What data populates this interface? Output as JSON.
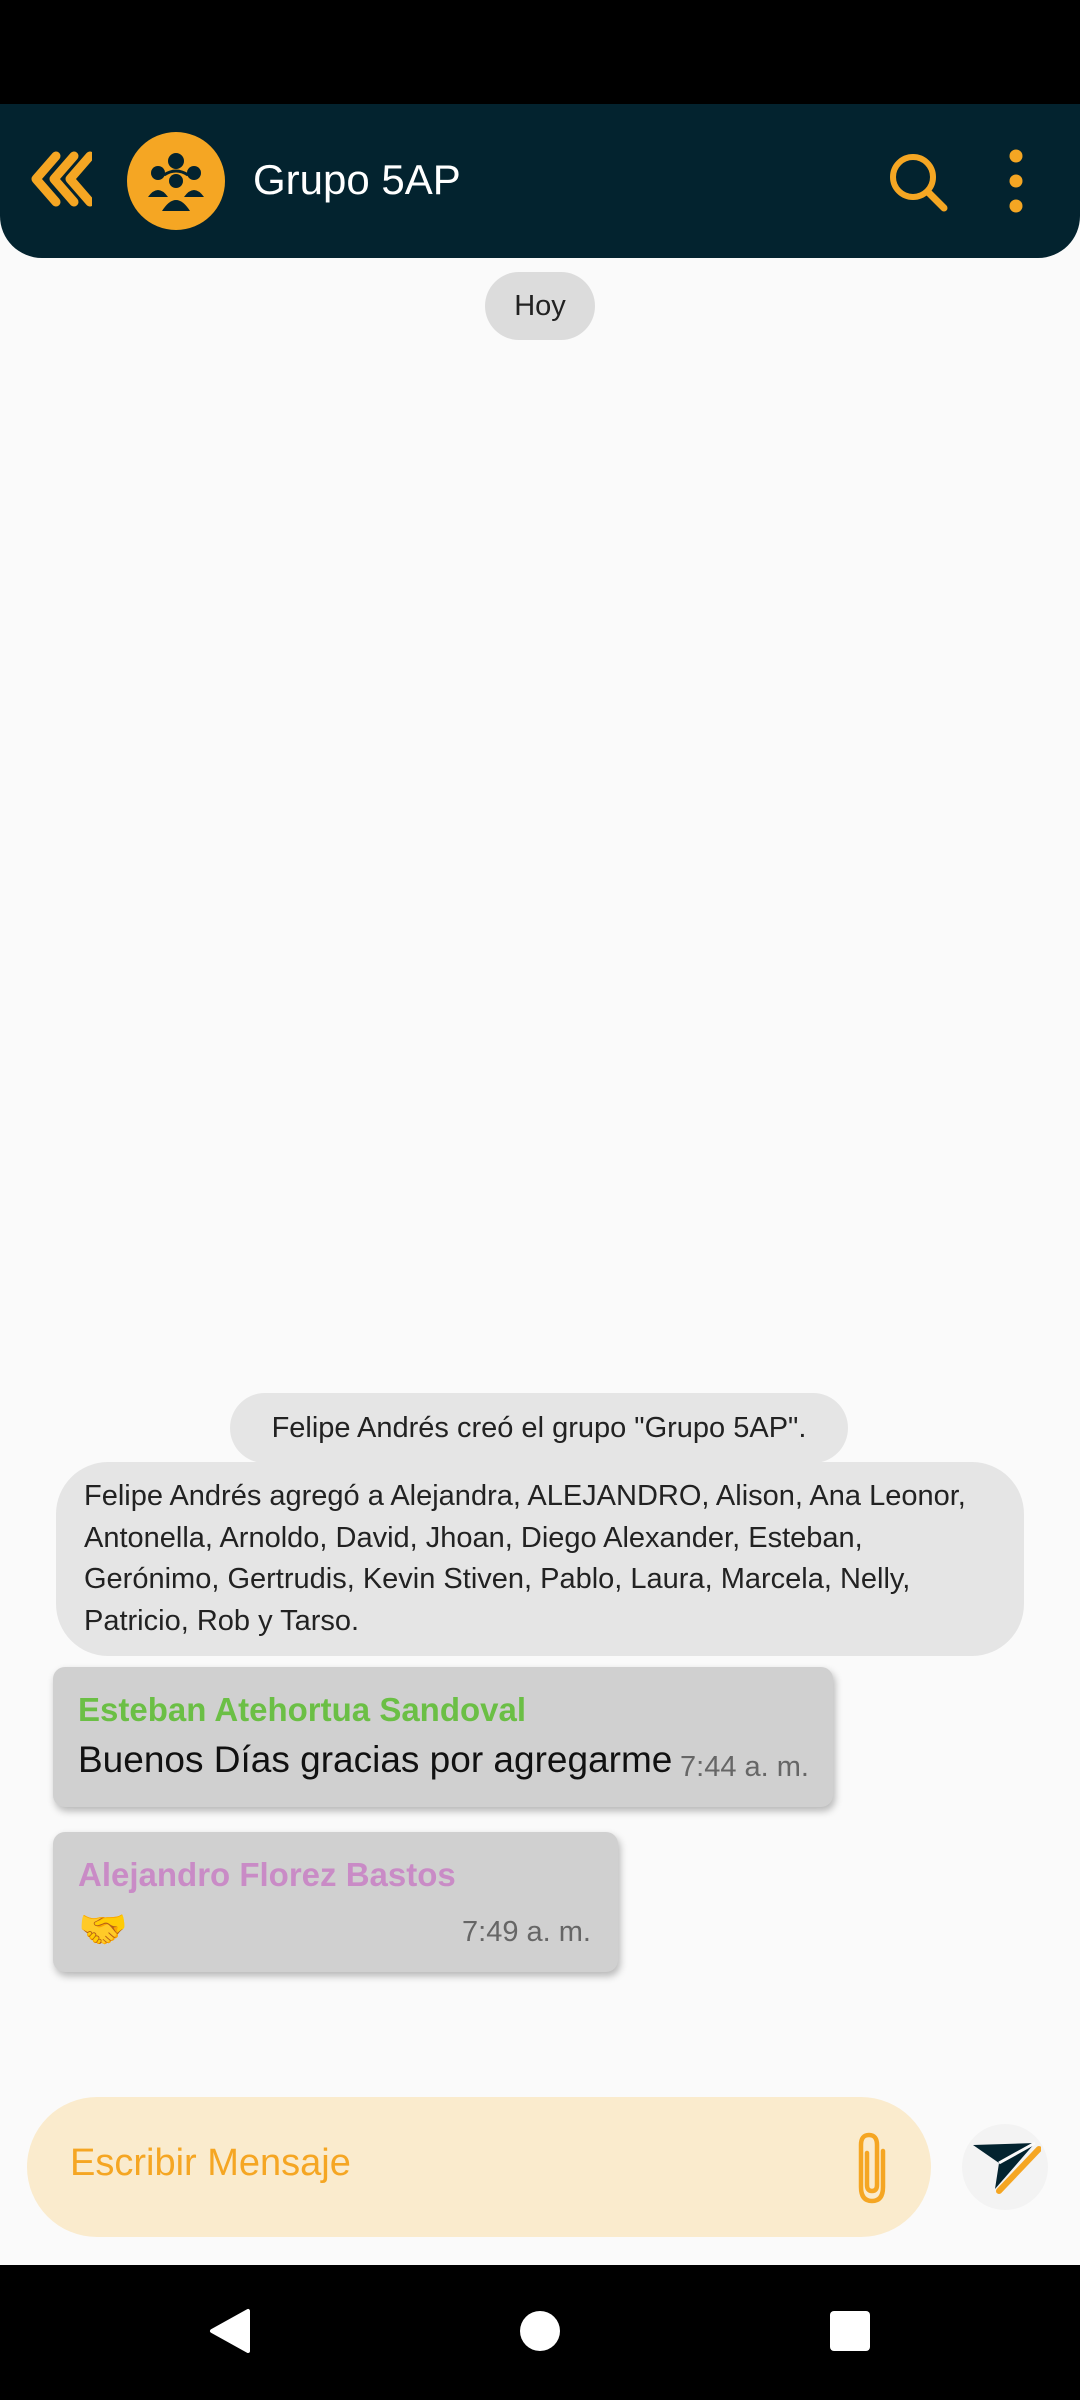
{
  "header": {
    "title": "Grupo 5AP",
    "back_icon": "chevron-double-left-icon",
    "avatar_icon": "group-people-icon",
    "search_icon": "search-icon",
    "menu_icon": "more-vertical-icon"
  },
  "chat": {
    "date_label": "Hoy",
    "system_messages": [
      "Felipe Andrés creó el grupo \"Grupo 5AP\".",
      "Felipe Andrés agregó a Alejandra, ALEJANDRO, Alison, Ana Leonor, Antonella, Arnoldo, David, Jhoan, Diego Alexander, Esteban, Gerónimo, Gertrudis, Kevin Stiven, Pablo, Laura, Marcela, Nelly, Patricio, Rob y Tarso."
    ],
    "messages": [
      {
        "sender": "Esteban Atehortua Sandoval",
        "text": "Buenos Días gracias por agregarme",
        "time": "7:44 a. m."
      },
      {
        "sender": "Alejandro Florez Bastos",
        "text": "🤝",
        "time": "7:49 a. m."
      }
    ]
  },
  "composer": {
    "placeholder": "Escribir Mensaje",
    "attach_icon": "paperclip-icon",
    "send_icon": "send-icon"
  },
  "colors": {
    "header_bg": "#03232f",
    "accent": "#f5a623",
    "input_bg": "#faebcd",
    "sender_1": "#6bbf45",
    "sender_2": "#c98bc6"
  }
}
